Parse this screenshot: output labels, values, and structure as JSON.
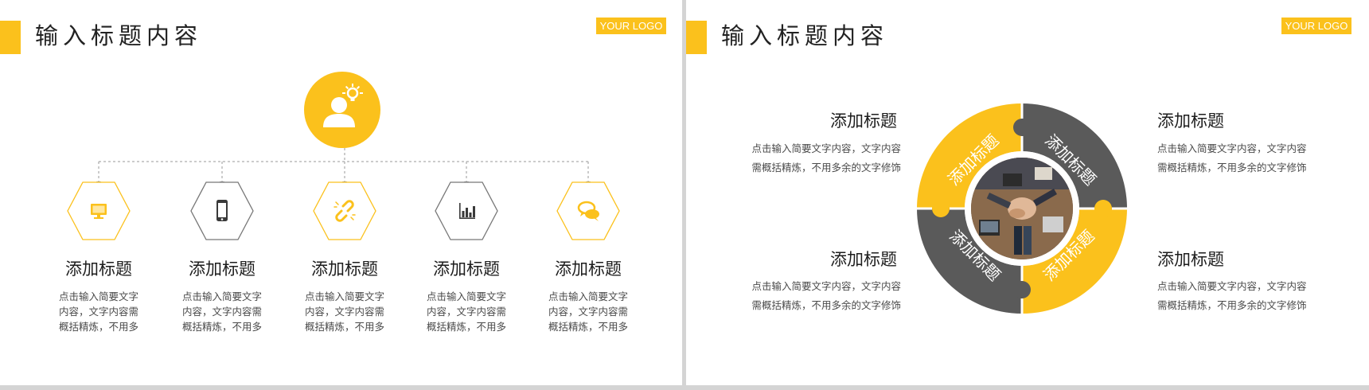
{
  "colors": {
    "accent": "#fbc11c",
    "dark": "#5a5a5a",
    "text": "#222222",
    "muted": "#4a4a4a",
    "outline": "#777777"
  },
  "left_slide": {
    "title": "输入标题内容",
    "logo": "YOUR LOGO",
    "main_icon": "person-lightbulb-icon",
    "columns": [
      {
        "icon": "monitor-icon",
        "style": "yellow",
        "title": "添加标题",
        "desc": "点击输入简要文字内容，文字内容需概括精炼，不用多余的文字修饰"
      },
      {
        "icon": "phone-icon",
        "style": "gray",
        "title": "添加标题",
        "desc": "点击输入简要文字内容，文字内容需概括精炼，不用多余的文字修饰"
      },
      {
        "icon": "broken-link-icon",
        "style": "yellow",
        "title": "添加标题",
        "desc": "点击输入简要文字内容，文字内容需概括精炼，不用多余的文字修饰"
      },
      {
        "icon": "bar-chart-icon",
        "style": "gray",
        "title": "添加标题",
        "desc": "点击输入简要文字内容，文字内容需概括精炼，不用多余的文字修饰"
      },
      {
        "icon": "chat-bubbles-icon",
        "style": "yellow",
        "title": "添加标题",
        "desc": "点击输入简要文字内容，文字内容需概括精炼，不用多余的文字修饰"
      }
    ]
  },
  "right_slide": {
    "title": "输入标题内容",
    "logo": "YOUR LOGO",
    "puzzle_labels": [
      "添加标题",
      "添加标题",
      "添加标题",
      "添加标题"
    ],
    "items": [
      {
        "title": "添加标题",
        "desc_line1": "点击输入简要文字内容，文字内容",
        "desc_line2": "需概括精炼，不用多余的文字修饰"
      },
      {
        "title": "添加标题",
        "desc_line1": "点击输入简要文字内容，文字内容",
        "desc_line2": "需概括精炼，不用多余的文字修饰"
      },
      {
        "title": "添加标题",
        "desc_line1": "点击输入简要文字内容，文字内容",
        "desc_line2": "需概括精炼，不用多余的文字修饰"
      },
      {
        "title": "添加标题",
        "desc_line1": "点击输入简要文字内容，文字内容",
        "desc_line2": "需概括精炼，不用多余的文字修饰"
      }
    ]
  }
}
